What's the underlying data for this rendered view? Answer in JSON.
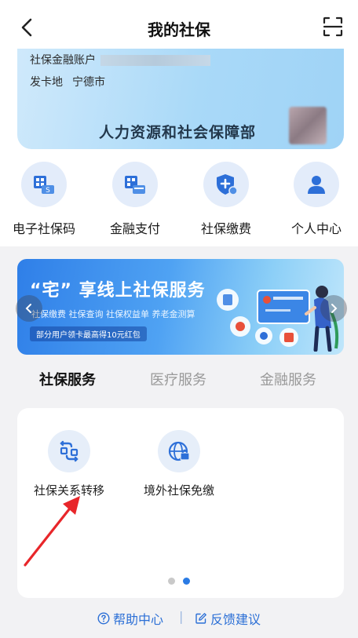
{
  "nav": {
    "title": "我的社保"
  },
  "card": {
    "account_label": "社保金融账户",
    "place_label": "发卡地",
    "place_value": "宁德市",
    "issuer": "人力资源和社会保障部"
  },
  "quick_actions": [
    {
      "label": "电子社保码",
      "icon": "qr-card-icon"
    },
    {
      "label": "金融支付",
      "icon": "qr-pay-icon"
    },
    {
      "label": "社保缴费",
      "icon": "shield-plus-icon"
    },
    {
      "label": "个人中心",
      "icon": "person-icon"
    }
  ],
  "banner": {
    "title": "“宅” 享线上社保服务",
    "subtitle": "社保缴费 社保查询 社保权益单 养老金测算",
    "tag": "部分用户领卡最高得10元红包",
    "slide_count": 2,
    "active_slide": 2
  },
  "tabs": [
    {
      "label": "社保服务",
      "active": true
    },
    {
      "label": "医疗服务",
      "active": false
    },
    {
      "label": "金融服务",
      "active": false
    }
  ],
  "services": [
    {
      "label": "社保关系转移",
      "icon": "transfer-icon"
    },
    {
      "label": "境外社保免缴",
      "icon": "globe-icon"
    }
  ],
  "pager": {
    "count": 2,
    "active": 2
  },
  "footer": {
    "help": "帮助中心",
    "separator": "|",
    "feedback": "反馈建议"
  },
  "colors": {
    "accent": "#2b6fd6",
    "annotation_arrow": "#e8262a"
  }
}
